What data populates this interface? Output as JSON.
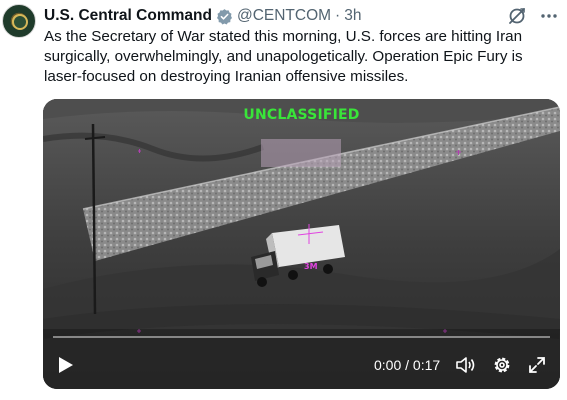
{
  "author": {
    "name": "U.S. Central Command",
    "handle": "@CENTCOM",
    "separator": "·",
    "time": "3h",
    "avatar_icon": "centcom-seal-icon",
    "verified_icon": "verified-badge-icon",
    "verified_color": "#829aab"
  },
  "tweet": {
    "text": "As the Secretary of War stated this morning, U.S. forces are hitting Iran surgically, overwhelmingly, and unapologetically. Operation Epic Fury is laser-focused on destroying Iranian offensive missiles."
  },
  "actions": {
    "grok_icon": "grok-icon",
    "more_icon": "more-options-icon"
  },
  "video": {
    "overlay_label": "UNCLASSIFIED",
    "overlay_color": "#39e639",
    "target_label": "3M",
    "target_color": "#e044e0",
    "current_time": "0:00",
    "time_separator": "/",
    "duration": "0:17",
    "progress": 0,
    "controls": {
      "play_icon": "play-icon",
      "volume_icon": "volume-icon",
      "settings_icon": "settings-gear-icon",
      "fullscreen_icon": "fullscreen-icon"
    }
  }
}
